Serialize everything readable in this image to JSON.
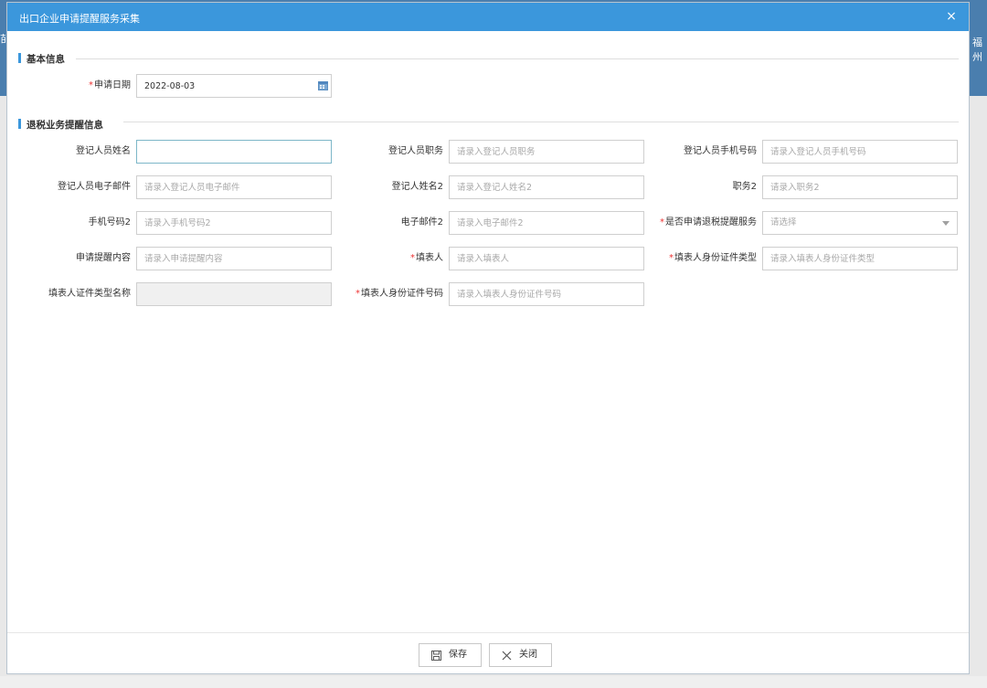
{
  "dialog": {
    "title": "出口企业申请提醒服务采集",
    "close_glyph": "×"
  },
  "background": {
    "right_text": "福州",
    "left_text": "苗"
  },
  "sections": {
    "basic": "基本信息",
    "reminder": "退税业务提醒信息"
  },
  "basic": {
    "apply_date_label": "申请日期",
    "apply_date_value": "2022-08-03"
  },
  "fields": {
    "reg_name": {
      "label": "登记人员姓名",
      "placeholder": ""
    },
    "reg_title": {
      "label": "登记人员职务",
      "placeholder": "请录入登记人员职务"
    },
    "reg_phone": {
      "label": "登记人员手机号码",
      "placeholder": "请录入登记人员手机号码"
    },
    "reg_email": {
      "label": "登记人员电子邮件",
      "placeholder": "请录入登记人员电子邮件"
    },
    "reg_name2": {
      "label": "登记人姓名2",
      "placeholder": "请录入登记人姓名2"
    },
    "title2": {
      "label": "职务2",
      "placeholder": "请录入职务2"
    },
    "phone2": {
      "label": "手机号码2",
      "placeholder": "请录入手机号码2"
    },
    "email2": {
      "label": "电子邮件2",
      "placeholder": "请录入电子邮件2"
    },
    "apply_service": {
      "label": "是否申请退税提醒服务",
      "value": "请选择"
    },
    "reminder_content": {
      "label": "申请提醒内容",
      "placeholder": "请录入申请提醒内容"
    },
    "filler": {
      "label": "填表人",
      "placeholder": "请录入填表人"
    },
    "filler_id_type": {
      "label": "填表人身份证件类型",
      "placeholder": "请录入填表人身份证件类型"
    },
    "filler_id_type_name": {
      "label": "填表人证件类型名称",
      "placeholder": ""
    },
    "filler_id_number": {
      "label": "填表人身份证件号码",
      "placeholder": "请录入填表人身份证件号码"
    }
  },
  "required_mark": "*",
  "buttons": {
    "save": "保存",
    "close": "关闭"
  }
}
